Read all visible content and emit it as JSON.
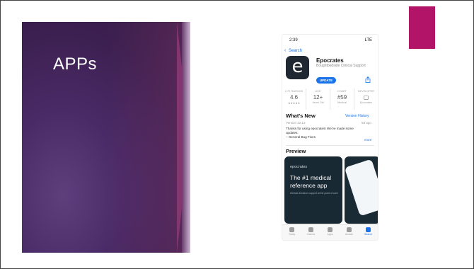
{
  "slide": {
    "title": "APPs",
    "colors": {
      "panel": "#3b1f4f",
      "accent": "#b21468"
    }
  },
  "phone": {
    "status": {
      "time": "2:39",
      "signal": "LTE"
    },
    "back_label": "Search",
    "app": {
      "name": "Epocrates",
      "developer": "Boughtbedside Clinical Support",
      "icon_letter": "e",
      "update_label": "UPDATE"
    },
    "stats": [
      {
        "header": "2.7K RATINGS",
        "value": "4.6",
        "sub": "★★★★★"
      },
      {
        "header": "AGE",
        "value": "12+",
        "sub": "Years Old"
      },
      {
        "header": "CHART",
        "value": "#59",
        "sub": "Medical"
      },
      {
        "header": "DEVELOPER",
        "value": "",
        "sub": "Epocrates"
      }
    ],
    "whats_new": {
      "heading": "What's New",
      "link": "Version History",
      "version": "Version 22.13",
      "ago": "5d ago",
      "body": "Thanks for using epocrates! We've made some updates:\n– General Bug Fixes",
      "more": "more"
    },
    "preview": {
      "heading": "Preview",
      "brand": "epocrates",
      "tagline": "The #1 medical reference app",
      "small": "Clinical decision support at the point of care"
    },
    "tabs": [
      {
        "label": "Today"
      },
      {
        "label": "Games"
      },
      {
        "label": "Apps"
      },
      {
        "label": "Arcade"
      },
      {
        "label": "Search"
      }
    ]
  }
}
